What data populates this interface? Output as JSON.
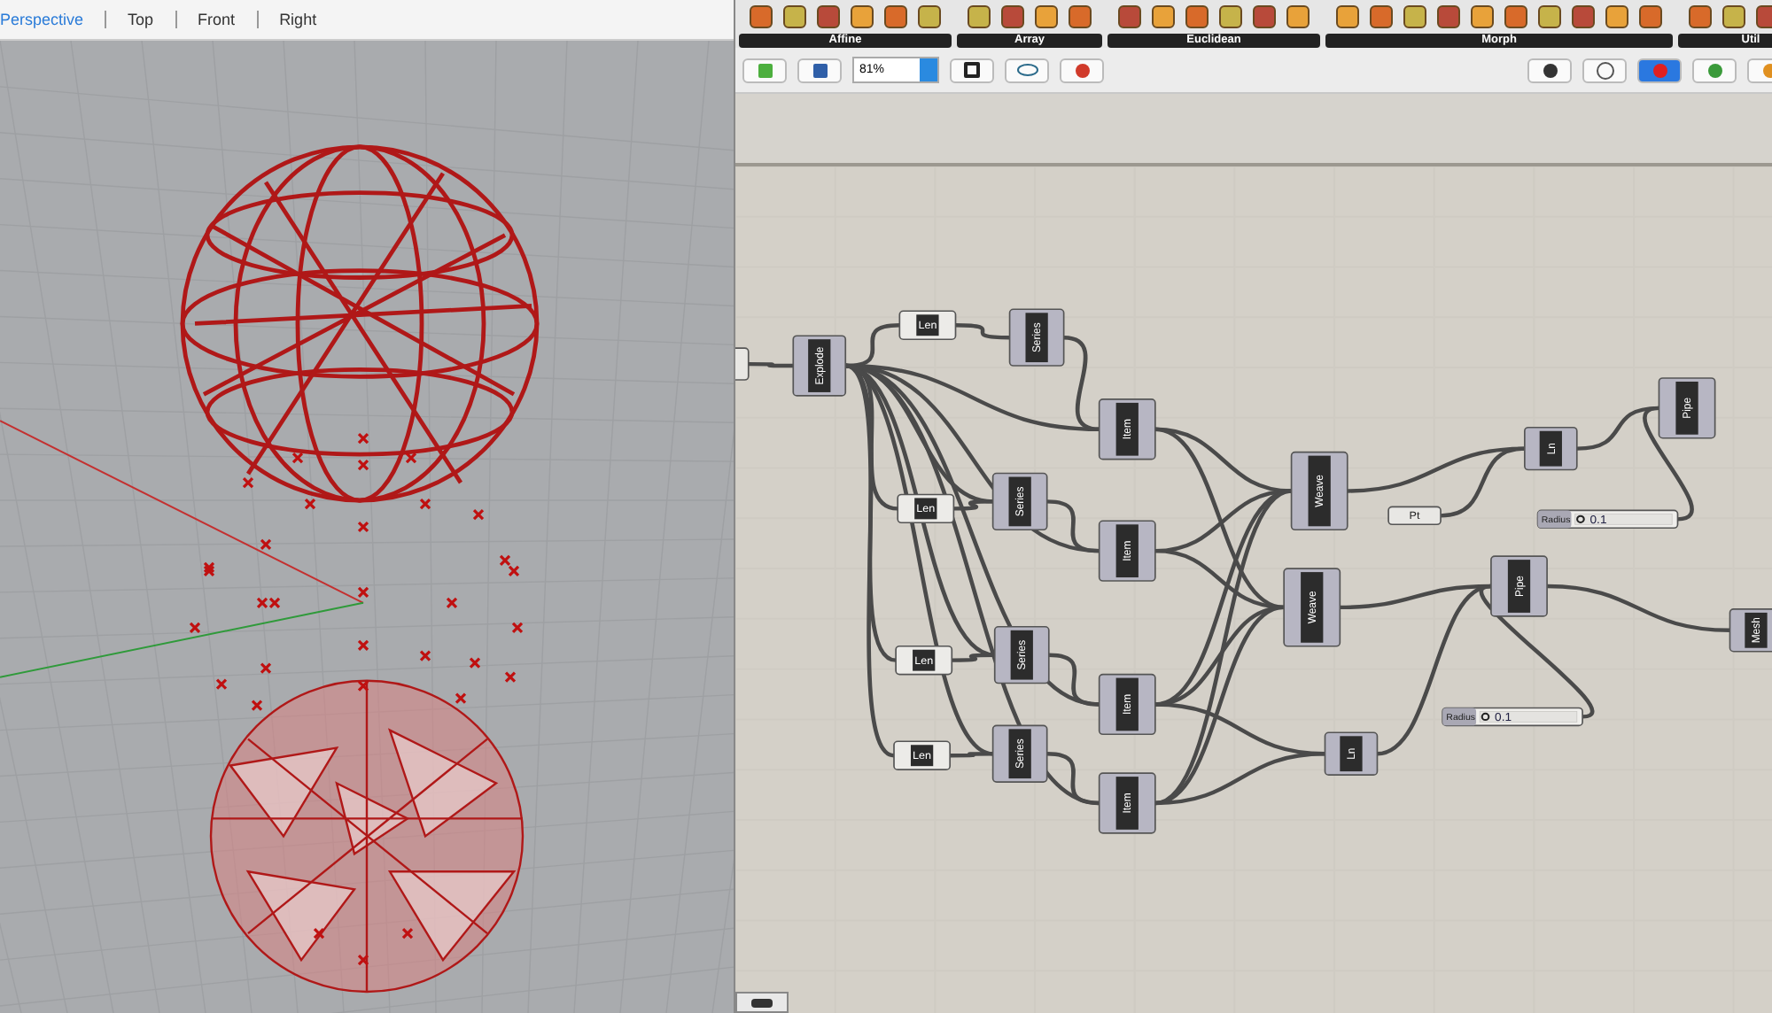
{
  "viewport": {
    "tabs": [
      {
        "label": "Perspective",
        "selected": true
      },
      {
        "label": "Top",
        "selected": false
      },
      {
        "label": "Front",
        "selected": false
      },
      {
        "label": "Right",
        "selected": false
      }
    ]
  },
  "ribbon": {
    "groups": [
      {
        "label": "Affine"
      },
      {
        "label": "Array"
      },
      {
        "label": "Euclidean"
      },
      {
        "label": "Morph"
      },
      {
        "label": "Util"
      }
    ]
  },
  "toolbar": {
    "zoom": "81%"
  },
  "canvas": {
    "nodes": [
      {
        "kind": "param"
      },
      {
        "kind": "component",
        "label": "Explode"
      },
      {
        "kind": "small",
        "label": "Len"
      },
      {
        "kind": "component",
        "label": "Series"
      },
      {
        "kind": "component",
        "label": "Item"
      },
      {
        "kind": "small",
        "label": "Len"
      },
      {
        "kind": "component",
        "label": "Series"
      },
      {
        "kind": "component",
        "label": "Item"
      },
      {
        "kind": "small",
        "label": "Len"
      },
      {
        "kind": "component",
        "label": "Series"
      },
      {
        "kind": "component",
        "label": "Item"
      },
      {
        "kind": "small",
        "label": "Len"
      },
      {
        "kind": "component",
        "label": "Series"
      },
      {
        "kind": "component",
        "label": "Item"
      },
      {
        "kind": "component",
        "label": "Weave"
      },
      {
        "kind": "component",
        "label": "Weave"
      },
      {
        "kind": "component",
        "label": "Ln"
      },
      {
        "kind": "component",
        "label": "Pipe"
      },
      {
        "kind": "param",
        "label": "Pt"
      },
      {
        "kind": "slider",
        "label": "Radius",
        "value": "0.1",
        "level": 0.02
      },
      {
        "kind": "component",
        "label": "Pipe"
      },
      {
        "kind": "component",
        "label": "Mesh"
      },
      {
        "kind": "component",
        "label": "Ln"
      },
      {
        "kind": "slider",
        "label": "Radius",
        "value": "0.1",
        "level": 0.02
      }
    ]
  }
}
